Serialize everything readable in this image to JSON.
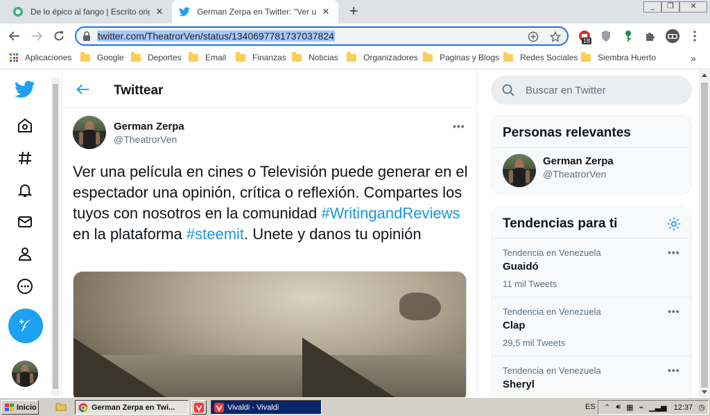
{
  "browser": {
    "tabs": [
      {
        "title": "De lo épico al fango | Escrito origina",
        "active": false
      },
      {
        "title": "German Zerpa en Twitter: \"Ver una",
        "active": true
      }
    ],
    "url": "twitter.com/TheatrorVen/status/1340697781737037824",
    "extension_badge": "18",
    "bookmarks": [
      {
        "label": "Aplicaciones",
        "icon": "apps-icon"
      },
      {
        "label": "Google",
        "icon": "folder-icon"
      },
      {
        "label": "Deportes",
        "icon": "folder-icon"
      },
      {
        "label": "Email",
        "icon": "folder-icon"
      },
      {
        "label": "Finanzas",
        "icon": "folder-icon"
      },
      {
        "label": "Noticias",
        "icon": "folder-icon"
      },
      {
        "label": "Organizadores",
        "icon": "folder-icon"
      },
      {
        "label": "Paginas y Blogs",
        "icon": "folder-icon"
      },
      {
        "label": "Redes Sociales",
        "icon": "folder-icon"
      },
      {
        "label": "Siembra Huerto",
        "icon": "folder-icon"
      }
    ],
    "bookmarks_overflow": "»"
  },
  "twitter": {
    "header_title": "Twittear",
    "tweet": {
      "author_name": "German Zerpa",
      "author_handle": "@TheatrorVen",
      "more": "•••",
      "text_segments": [
        {
          "text": "Ver una película en cines o Televisión  puede generar en el espectador una opinión, crítica o reflexión. Compartes los tuyos con nosotros en la comunidad ",
          "hashtag": false
        },
        {
          "text": "#WritingandReviews",
          "hashtag": true
        },
        {
          "text": " en la plataforma ",
          "hashtag": false
        },
        {
          "text": "#steemit",
          "hashtag": true
        },
        {
          "text": ". Unete y danos tu opinión",
          "hashtag": false
        }
      ]
    },
    "search_placeholder": "Buscar en Twitter",
    "relevant": {
      "title": "Personas relevantes",
      "name": "German Zerpa",
      "handle": "@TheatrorVen"
    },
    "trends": {
      "title": "Tendencias para ti",
      "items": [
        {
          "meta": "Tendencia en Venezuela",
          "name": "Guaidó",
          "count": "11 mil Tweets",
          "more": "•••"
        },
        {
          "meta": "Tendencia en Venezuela",
          "name": "Clap",
          "count": "29,5 mil Tweets",
          "more": "•••"
        },
        {
          "meta": "Tendencia en Venezuela",
          "name": "Sheryl",
          "count": "",
          "more": "•••"
        }
      ]
    },
    "colors": {
      "accent": "#1da1f2",
      "hashtag": "#1b95e0"
    }
  },
  "taskbar": {
    "start": "Inicio",
    "tasks": [
      {
        "label": "German Zerpa en Twi...",
        "icon": "chrome-icon"
      },
      {
        "label": "Vivaldi - Vivaldi",
        "icon": "vivaldi-icon"
      }
    ],
    "language": "ES",
    "clock": "12:37"
  }
}
